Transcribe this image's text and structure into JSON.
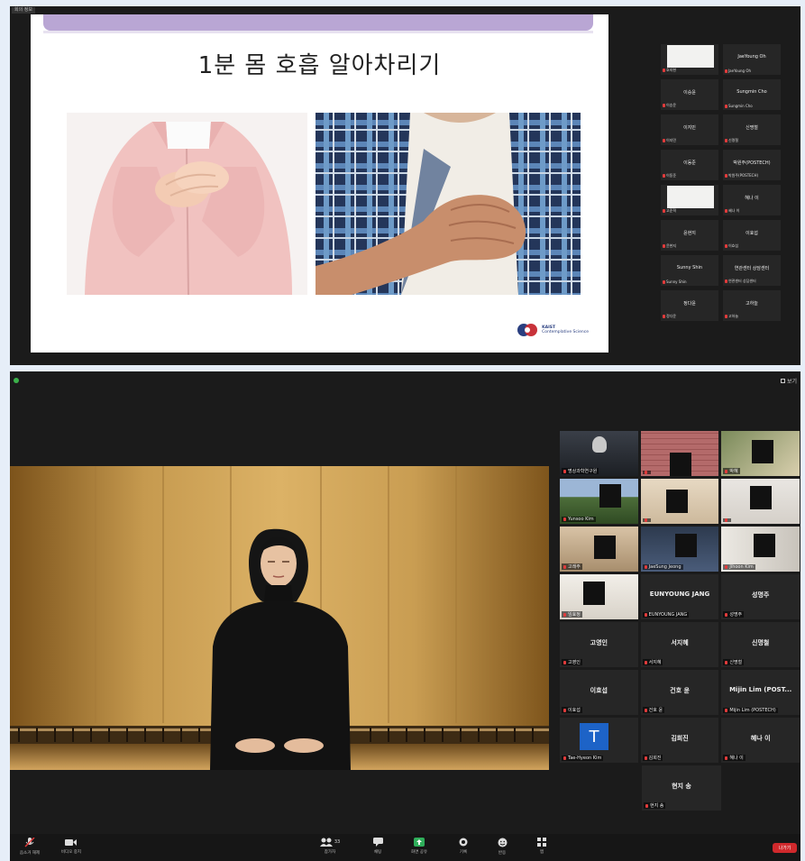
{
  "screen1": {
    "window_tag": "회의 정보",
    "slide": {
      "title": "1분 몸 호흡 알아차리기",
      "logo_name": "KAIST",
      "logo_line2": "Contemplative Science"
    },
    "participants": [
      {
        "name": "",
        "label": "호지현",
        "video": true
      },
      {
        "name": "JaeYoung Oh",
        "label": "JaeYoung Oh"
      },
      {
        "name": "이승윤",
        "label": "이승윤"
      },
      {
        "name": "Sungmin Cho",
        "label": "Sungmin Cho"
      },
      {
        "name": "이지민",
        "label": "이지민"
      },
      {
        "name": "신명철",
        "label": "신명철"
      },
      {
        "name": "이동준",
        "label": "이동준"
      },
      {
        "name": "박원주(POSTECH)",
        "label": "박원주(POSTECH)"
      },
      {
        "name": "",
        "label": "고준혁",
        "video": true
      },
      {
        "name": "혜나 이",
        "label": "혜나 이"
      },
      {
        "name": "윤현지",
        "label": "윤현지"
      },
      {
        "name": "이효섭",
        "label": "이효섭"
      },
      {
        "name": "Sunny Shin",
        "label": "Sunny Shin"
      },
      {
        "name": "연관센터 상담센터",
        "label": "연관센터 상담센터"
      },
      {
        "name": "정다윤",
        "label": "정다윤"
      },
      {
        "name": "고하늘",
        "label": "고하늘"
      }
    ]
  },
  "screen2": {
    "view_label": "보기",
    "grid": [
      {
        "label": "명상과학연구원",
        "type": "active"
      },
      {
        "label": "",
        "type": "pic-brick"
      },
      {
        "label": "박혜",
        "type": "pic-room"
      },
      {
        "label": "Yunsoo Kim",
        "type": "pic-mountain"
      },
      {
        "label": "",
        "type": "pic-door"
      },
      {
        "label": "",
        "type": "pic-plain"
      },
      {
        "label": "고래주",
        "type": "pic-wall"
      },
      {
        "label": "JaeSung Jeong",
        "type": "pic-dark"
      },
      {
        "label": "Jihoon Kim",
        "type": "pic-window"
      },
      {
        "label": "임효정",
        "type": "pic-bright"
      },
      {
        "label": "EUNYOUNG JANG",
        "name": "EUNYOUNG JANG",
        "type": "name"
      },
      {
        "label": "성명주",
        "name": "성명주",
        "type": "name"
      },
      {
        "label": "고영인",
        "name": "고영인",
        "type": "name"
      },
      {
        "label": "서지혜",
        "name": "서지혜",
        "type": "name"
      },
      {
        "label": "신명철",
        "name": "신명철",
        "type": "name"
      },
      {
        "label": "이효섭",
        "name": "이효섭",
        "type": "name"
      },
      {
        "label": "건호 윤",
        "name": "건호 윤",
        "type": "name"
      },
      {
        "label": "Mijin Lim (POSTECH)",
        "name": "Mijin Lim (POST...",
        "type": "name"
      },
      {
        "label": "Tae-Hyeon Kim",
        "avatar": "T",
        "type": "avatar"
      },
      {
        "label": "김희진",
        "name": "김희진",
        "type": "name"
      },
      {
        "label": "혜나 이",
        "name": "혜나 이",
        "type": "name"
      },
      {
        "label": "현지 송",
        "name": "현지 송",
        "type": "name"
      }
    ],
    "toolbar": {
      "unmute": "음소거 해제",
      "video": "비디오 중지",
      "participants": "참가자",
      "participants_count": "33",
      "chat": "채팅",
      "share": "화면 공유",
      "record": "기록",
      "reactions": "반응",
      "apps": "앱",
      "leave": "나가기"
    }
  },
  "colors": {
    "window_bg": "#1b1b1b",
    "slide_accent": "#b9a6d4",
    "share_green": "#2fae5a",
    "leave_red": "#d0292c",
    "active_speaker": "#c9d35a",
    "avatar_blue": "#1d63c7"
  }
}
